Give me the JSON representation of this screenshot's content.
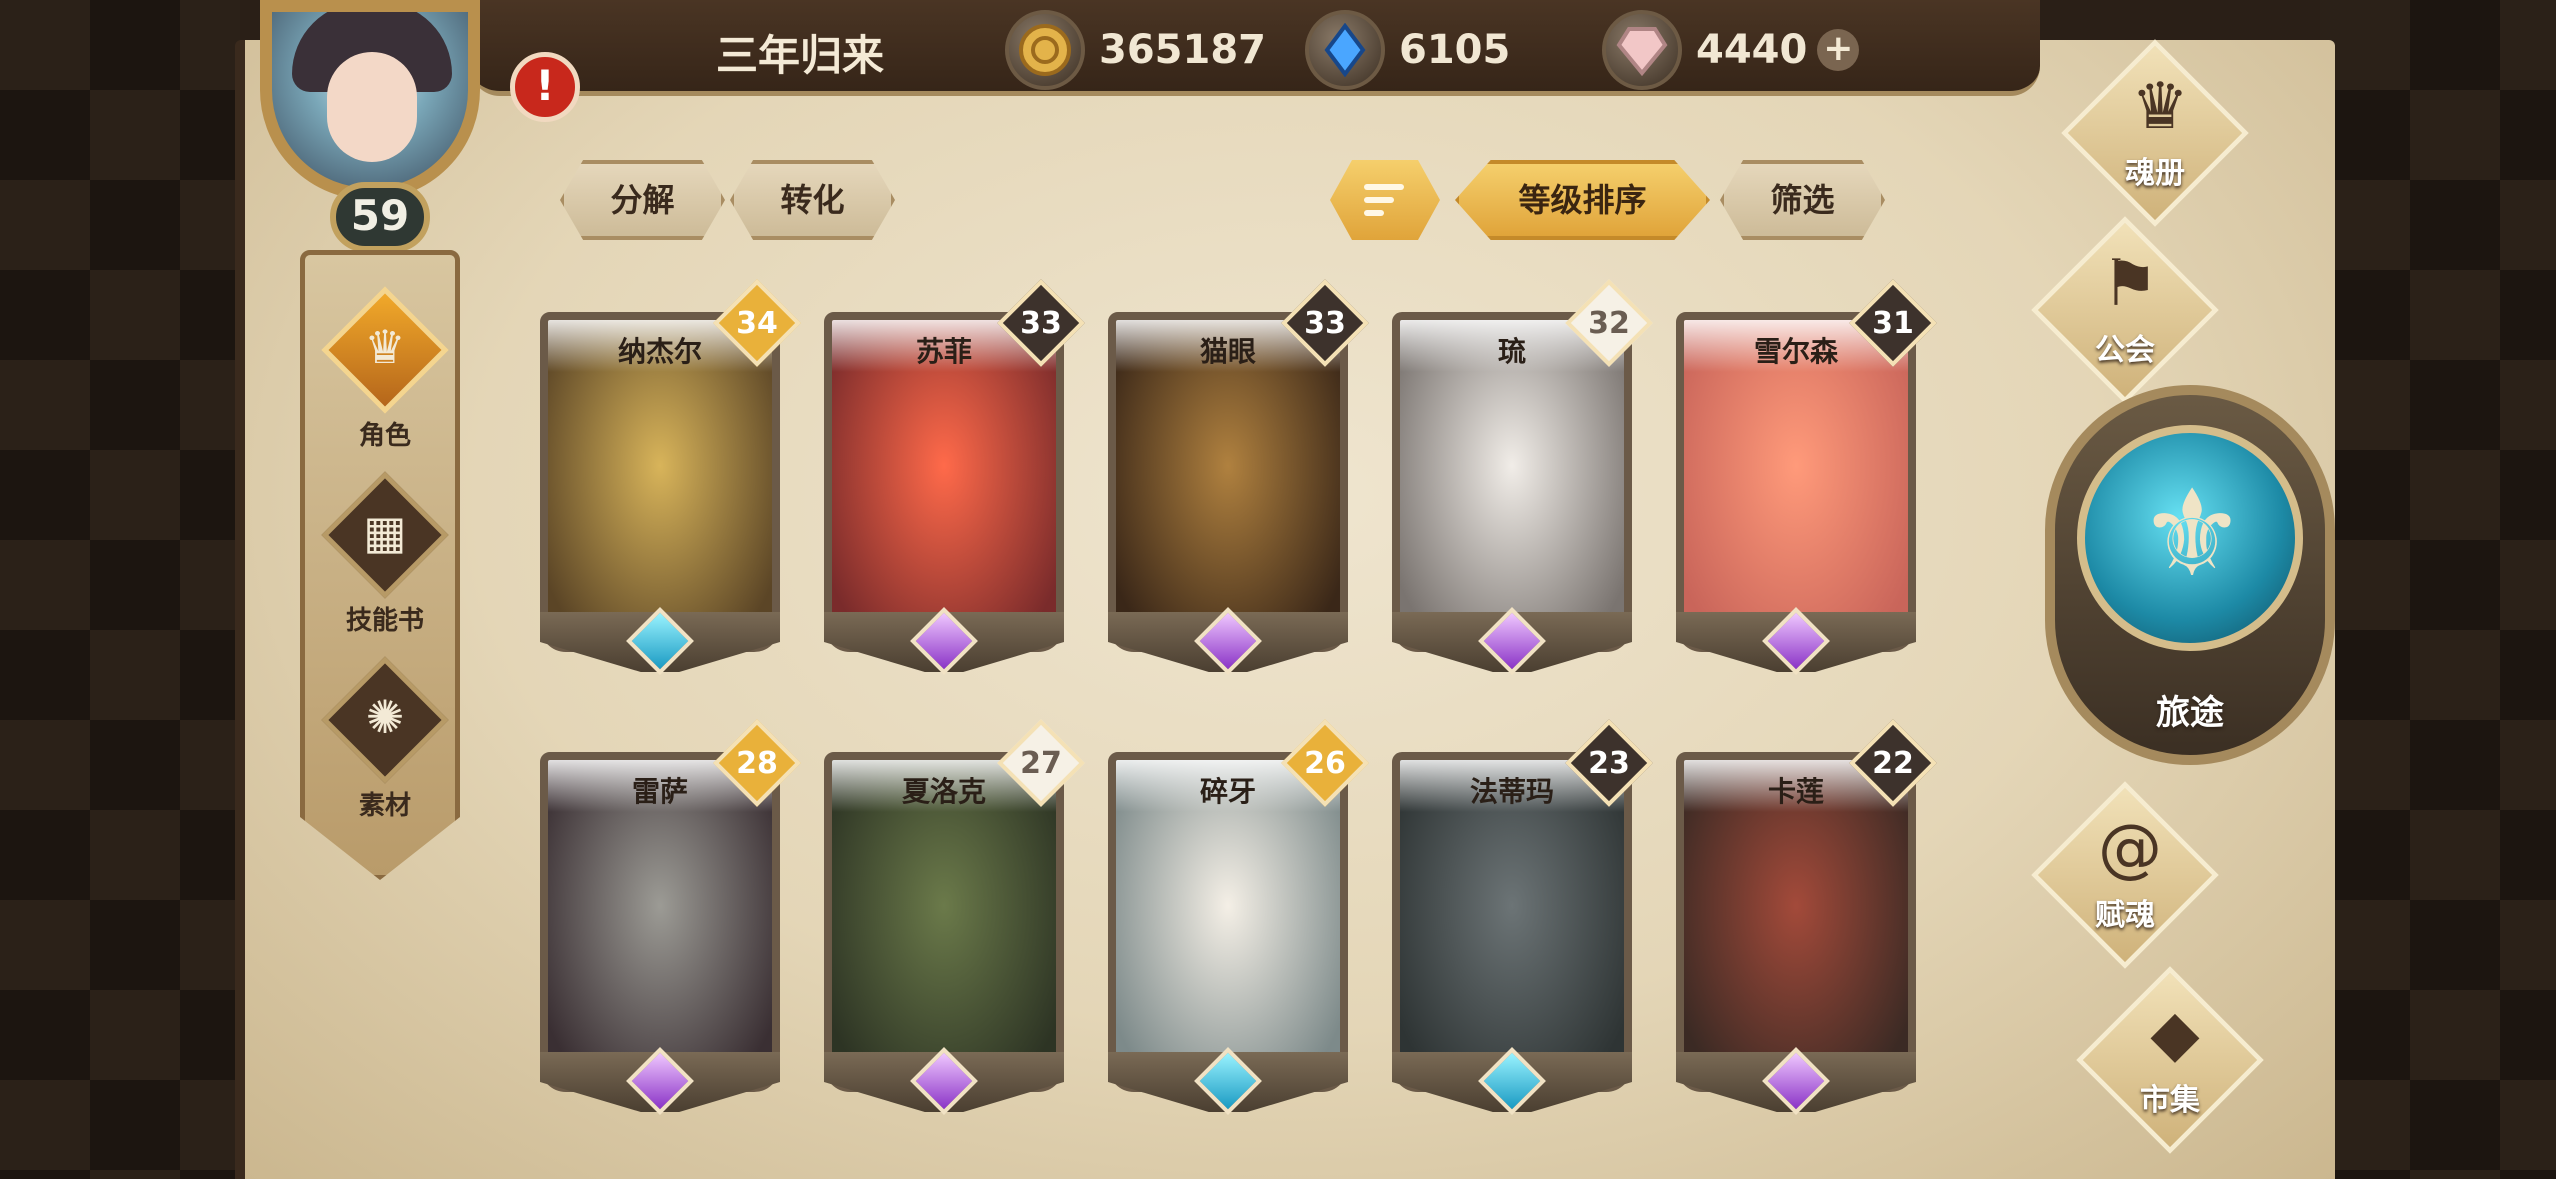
{
  "header": {
    "title": "三年归来",
    "resources": [
      {
        "icon": "gold-coin-icon",
        "value": "365187"
      },
      {
        "icon": "blue-crystal-icon",
        "value": "6105"
      },
      {
        "icon": "pink-gem-icon",
        "value": "4440"
      }
    ],
    "plus": "+"
  },
  "player": {
    "level": "59",
    "alert": "!"
  },
  "left_nav": [
    {
      "label": "角色",
      "icon": "helmet-icon",
      "active": true
    },
    {
      "label": "技能书",
      "icon": "book-icon",
      "active": false
    },
    {
      "label": "素材",
      "icon": "material-icon",
      "active": false
    }
  ],
  "toolbar": {
    "decompose": "分解",
    "convert": "转化",
    "sort_by_level": "等级排序",
    "filter": "筛选"
  },
  "cards": [
    {
      "name": "纳杰尔",
      "level": "34",
      "badge": "gold",
      "gem": "blue",
      "palette": [
        "#d8b45a",
        "#5b4526"
      ]
    },
    {
      "name": "苏菲",
      "level": "33",
      "badge": "dark",
      "gem": "purple",
      "palette": [
        "#ff6a4a",
        "#7a2b2b"
      ]
    },
    {
      "name": "猫眼",
      "level": "33",
      "badge": "dark",
      "gem": "purple",
      "palette": [
        "#b0813f",
        "#3a2718"
      ]
    },
    {
      "name": "琉",
      "level": "32",
      "badge": "white",
      "gem": "purple",
      "palette": [
        "#f1ede8",
        "#7a7470"
      ]
    },
    {
      "name": "雪尔森",
      "level": "31",
      "badge": "dark",
      "gem": "purple",
      "palette": [
        "#ff9a7a",
        "#c9655a"
      ]
    },
    {
      "name": "雷萨",
      "level": "28",
      "badge": "gold",
      "gem": "purple",
      "palette": [
        "#9c9b95",
        "#3a2f33"
      ]
    },
    {
      "name": "夏洛克",
      "level": "27",
      "badge": "white",
      "gem": "purple",
      "palette": [
        "#6b7a4a",
        "#2d3424"
      ]
    },
    {
      "name": "碎牙",
      "level": "26",
      "badge": "gold",
      "gem": "blue",
      "palette": [
        "#f4efe6",
        "#7d8a8a"
      ]
    },
    {
      "name": "法蒂玛",
      "level": "23",
      "badge": "dark",
      "gem": "blue",
      "palette": [
        "#6c7476",
        "#2e3434"
      ]
    },
    {
      "name": "卡莲",
      "level": "22",
      "badge": "dark",
      "gem": "purple",
      "palette": [
        "#a34a3a",
        "#3b2a24"
      ]
    }
  ],
  "right_menu": [
    {
      "label": "魂册",
      "icon": "helmet-icon"
    },
    {
      "label": "公会",
      "icon": "guild-icon"
    },
    {
      "label": "旅途",
      "icon": "journey-emblem-icon"
    },
    {
      "label": "赋魂",
      "icon": "soul-swirl-icon"
    },
    {
      "label": "市集",
      "icon": "market-gem-icon"
    }
  ],
  "colors": {
    "badge_gold": "#e9b13a",
    "badge_dark": "#3d322c",
    "badge_white": "#f6f1e6"
  }
}
